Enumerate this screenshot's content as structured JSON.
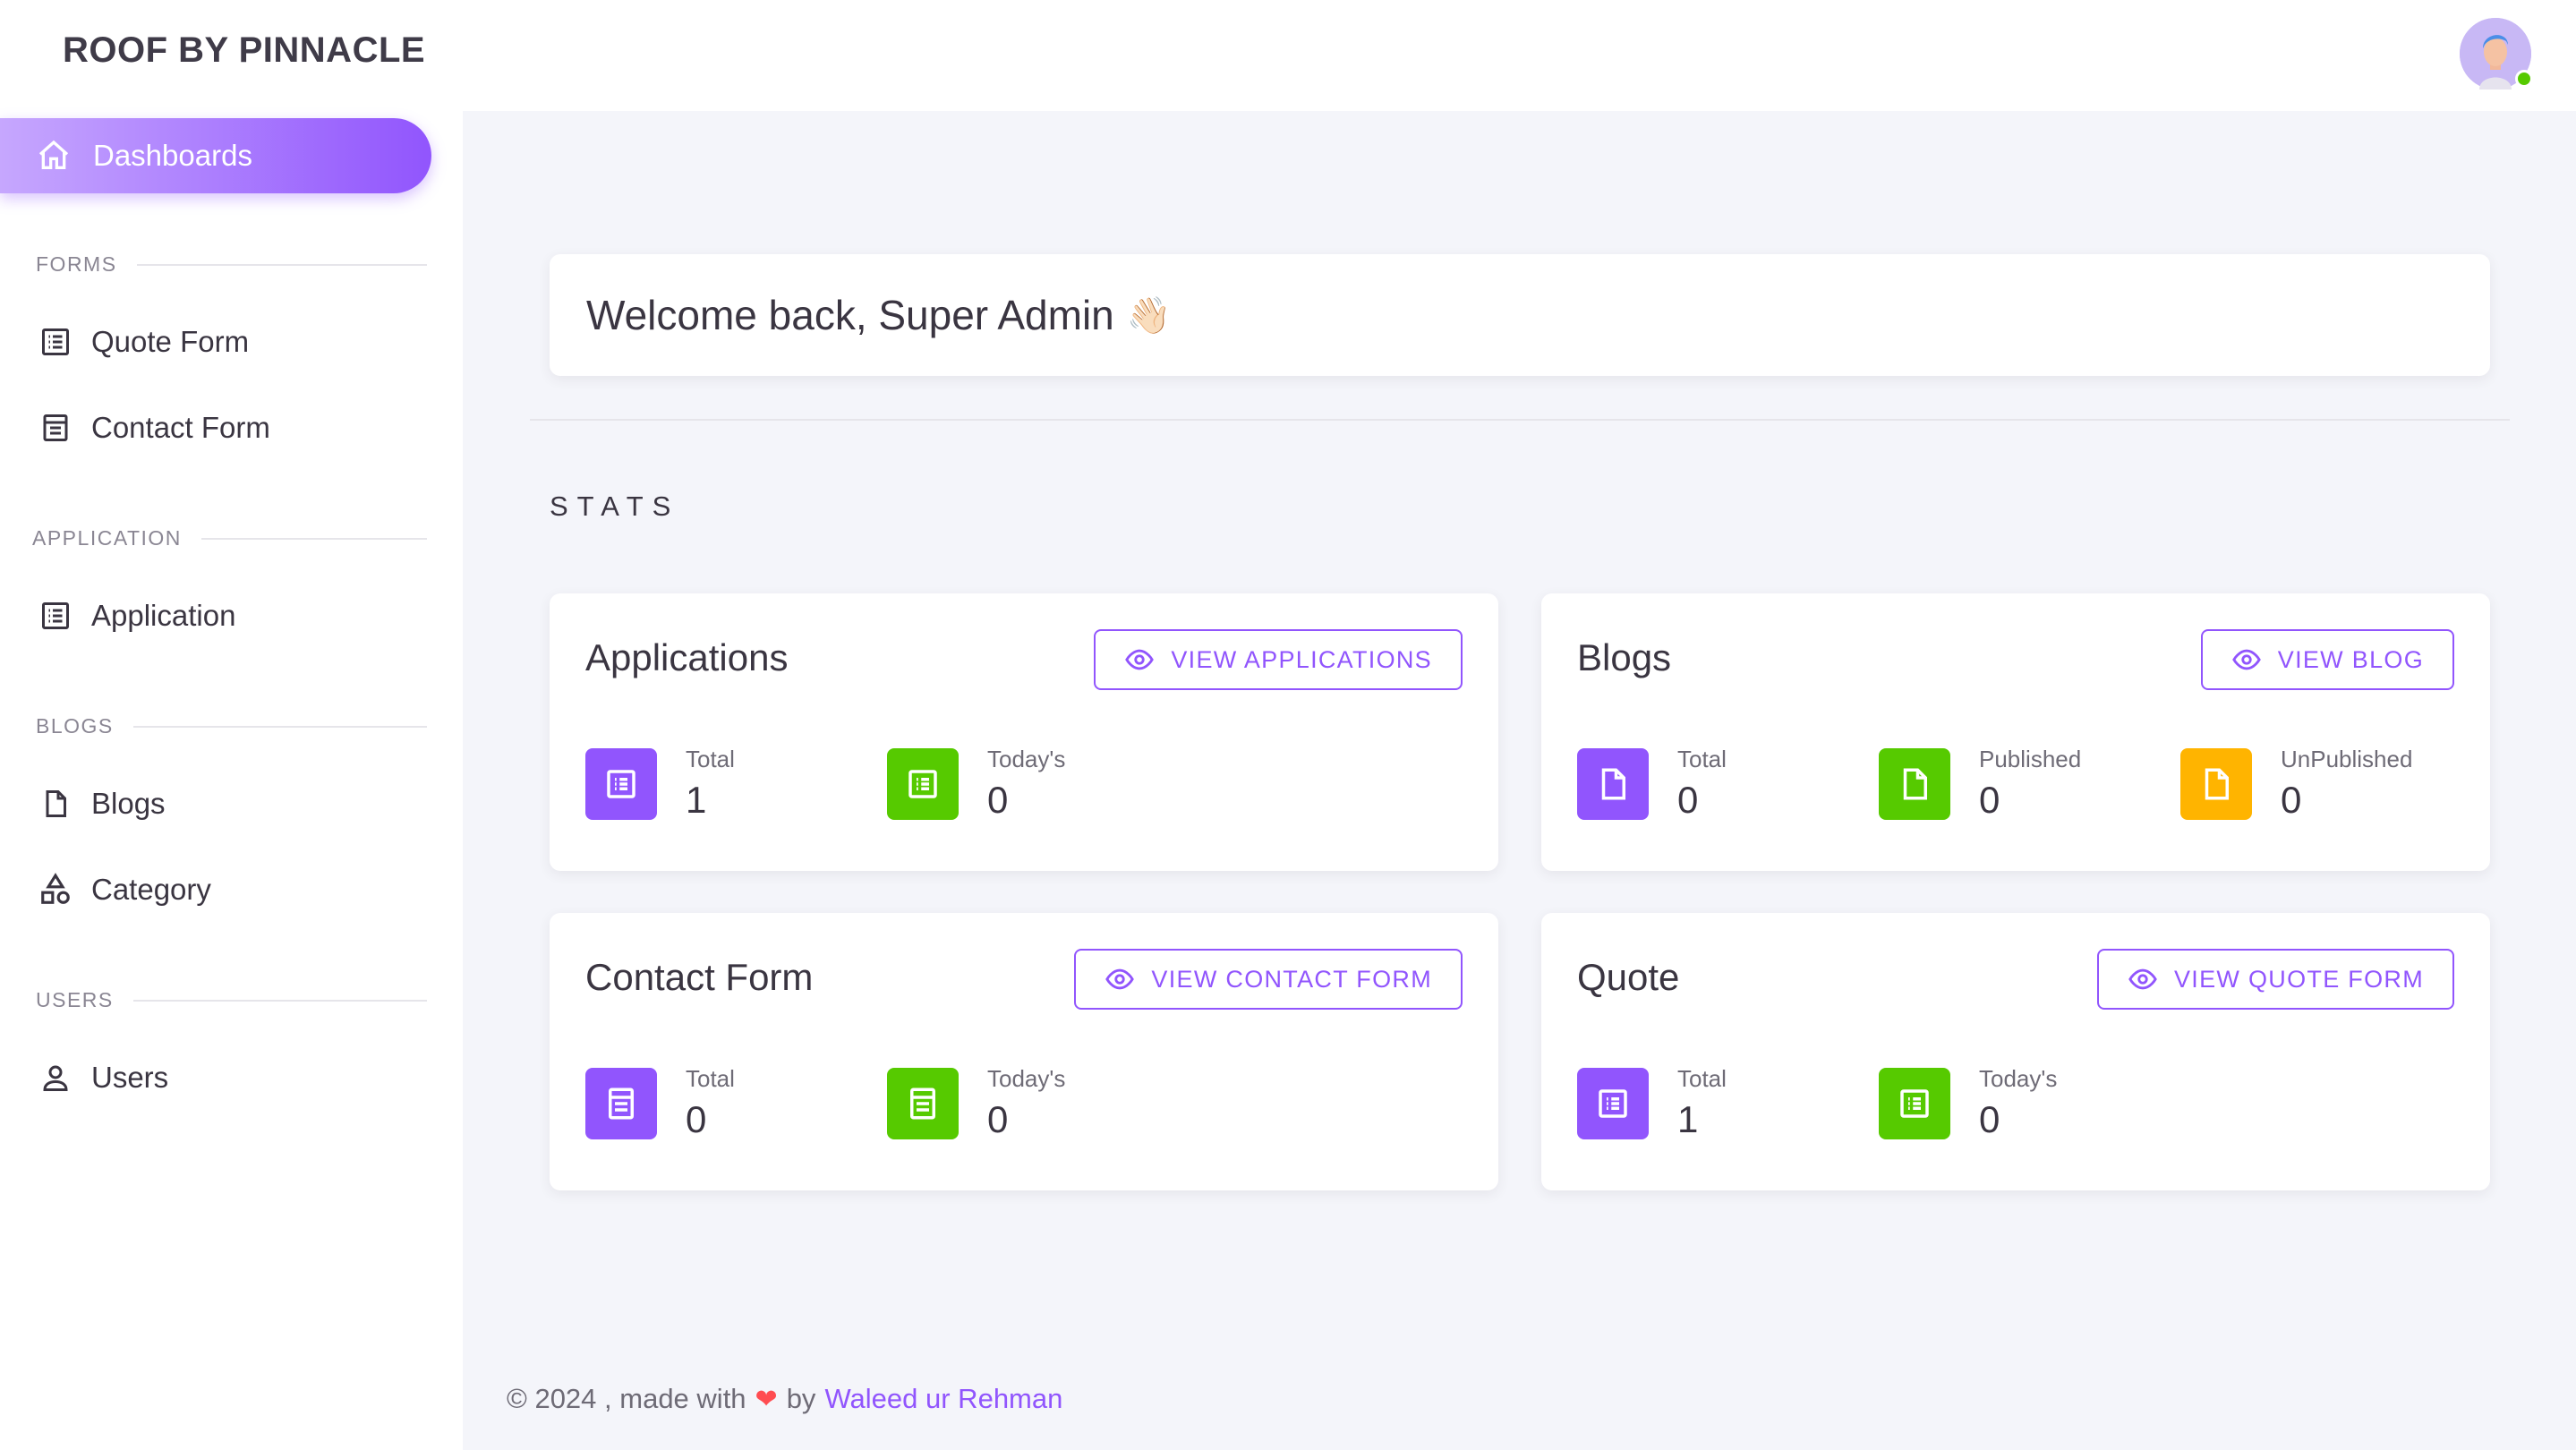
{
  "brand": "ROOF BY PINNACLE",
  "sidebar": {
    "active": {
      "label": "Dashboards",
      "icon": "home-icon"
    },
    "sections": [
      {
        "title": "FORMS",
        "items": [
          {
            "label": "Quote Form",
            "icon": "list-icon"
          },
          {
            "label": "Contact Form",
            "icon": "form-icon"
          }
        ]
      },
      {
        "title": "APPLICATION",
        "items": [
          {
            "label": "Application",
            "icon": "list-icon"
          }
        ]
      },
      {
        "title": "BLOGS",
        "items": [
          {
            "label": "Blogs",
            "icon": "file-icon"
          },
          {
            "label": "Category",
            "icon": "shapes-icon"
          }
        ]
      },
      {
        "title": "USERS",
        "items": [
          {
            "label": "Users",
            "icon": "user-icon"
          }
        ]
      }
    ]
  },
  "welcome": {
    "text": "Welcome back, Super Admin",
    "emoji": "👋🏻"
  },
  "stats_title": "STATS",
  "cards": {
    "applications": {
      "title": "Applications",
      "button": "VIEW APPLICATIONS",
      "stats": [
        {
          "label": "Total",
          "value": "1",
          "color": "#9155fd"
        },
        {
          "label": "Today's",
          "value": "0",
          "color": "#56ca00"
        }
      ]
    },
    "blogs": {
      "title": "Blogs",
      "button": "VIEW BLOG",
      "stats": [
        {
          "label": "Total",
          "value": "0",
          "color": "#9155fd"
        },
        {
          "label": "Published",
          "value": "0",
          "color": "#56ca00"
        },
        {
          "label": "UnPublished",
          "value": "0",
          "color": "#ffb400"
        }
      ]
    },
    "contact": {
      "title": "Contact Form",
      "button": "VIEW CONTACT FORM",
      "stats": [
        {
          "label": "Total",
          "value": "0",
          "color": "#9155fd"
        },
        {
          "label": "Today's",
          "value": "0",
          "color": "#56ca00"
        }
      ]
    },
    "quote": {
      "title": "Quote",
      "button": "VIEW QUOTE FORM",
      "stats": [
        {
          "label": "Total",
          "value": "1",
          "color": "#9155fd"
        },
        {
          "label": "Today's",
          "value": "0",
          "color": "#56ca00"
        }
      ]
    }
  },
  "footer": {
    "prefix": "© 2024 , made with",
    "by": "by",
    "author": "Waleed ur Rehman"
  },
  "colors": {
    "primary": "#9155fd",
    "success": "#56ca00",
    "warning": "#ffb400",
    "error": "#ff4c51"
  }
}
